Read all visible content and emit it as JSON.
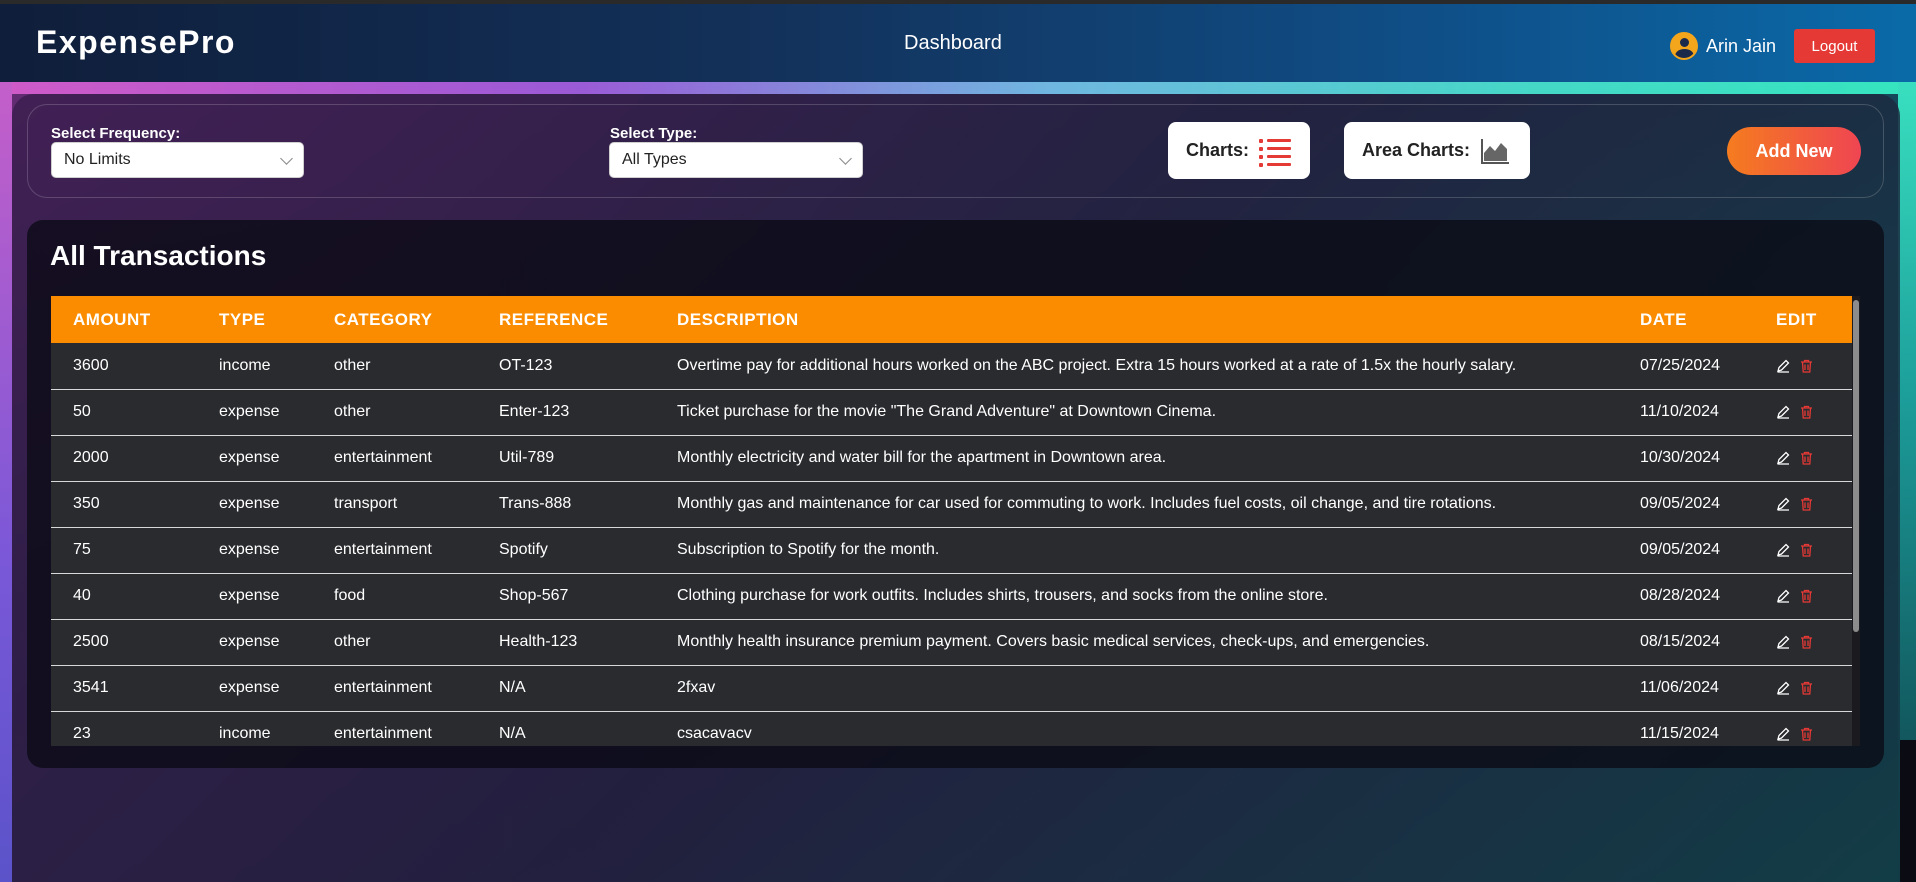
{
  "header": {
    "brand": "ExpensePro",
    "title": "Dashboard",
    "user_name": "Arin Jain",
    "logout_label": "Logout"
  },
  "filters": {
    "frequency_label": "Select Frequency:",
    "frequency_value": "No Limits",
    "type_label": "Select Type:",
    "type_value": "All Types",
    "charts_label": "Charts:",
    "area_charts_label": "Area Charts:",
    "add_new_label": "Add New"
  },
  "transactions": {
    "title": "All Transactions",
    "columns": [
      "AMOUNT",
      "TYPE",
      "CATEGORY",
      "REFERENCE",
      "DESCRIPTION",
      "DATE",
      "EDIT"
    ],
    "rows": [
      {
        "amount": "3600",
        "type": "income",
        "category": "other",
        "reference": "OT-123",
        "description": "Overtime pay for additional hours worked on the ABC project. Extra 15 hours worked at a rate of 1.5x the hourly salary.",
        "date": "07/25/2024"
      },
      {
        "amount": "50",
        "type": "expense",
        "category": "other",
        "reference": "Enter-123",
        "description": "Ticket purchase for the movie \"The Grand Adventure\" at Downtown Cinema.",
        "date": "11/10/2024"
      },
      {
        "amount": "2000",
        "type": "expense",
        "category": "entertainment",
        "reference": "Util-789",
        "description": "Monthly electricity and water bill for the apartment in Downtown area.",
        "date": "10/30/2024"
      },
      {
        "amount": "350",
        "type": "expense",
        "category": "transport",
        "reference": "Trans-888",
        "description": "Monthly gas and maintenance for car used for commuting to work. Includes fuel costs, oil change, and tire rotations.",
        "date": "09/05/2024"
      },
      {
        "amount": "75",
        "type": "expense",
        "category": "entertainment",
        "reference": "Spotify",
        "description": "Subscription to Spotify for the month.",
        "date": "09/05/2024"
      },
      {
        "amount": "40",
        "type": "expense",
        "category": "food",
        "reference": "Shop-567",
        "description": "Clothing purchase for work outfits. Includes shirts, trousers, and socks from the online store.",
        "date": "08/28/2024"
      },
      {
        "amount": "2500",
        "type": "expense",
        "category": "other",
        "reference": "Health-123",
        "description": "Monthly health insurance premium payment. Covers basic medical services, check-ups, and emergencies.",
        "date": "08/15/2024"
      },
      {
        "amount": "3541",
        "type": "expense",
        "category": "entertainment",
        "reference": "N/A",
        "description": "2fxav",
        "date": "11/06/2024"
      },
      {
        "amount": "23",
        "type": "income",
        "category": "entertainment",
        "reference": "N/A",
        "description": "csacavacv",
        "date": "11/15/2024"
      }
    ]
  },
  "colors": {
    "accent_orange": "#fb8c00",
    "danger_red": "#e53935",
    "avatar_gold": "#f3a51b"
  },
  "icons": {
    "avatar": "user-circle-icon",
    "charts": "list-icon",
    "area_charts": "area-chart-icon",
    "edit": "pencil-icon",
    "delete": "trash-icon"
  }
}
